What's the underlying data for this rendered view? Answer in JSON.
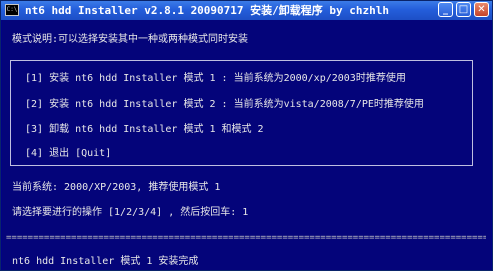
{
  "window": {
    "title": "nt6 hdd Installer v2.8.1 20090717 安装/卸载程序 by chzhlh",
    "icon": "console-app-icon",
    "controls": {
      "minimize_glyph": "_",
      "maximize_glyph": "□",
      "close_glyph": "✕"
    }
  },
  "console": {
    "mode_description": "模式说明:可以选择安装其中一种或两种模式同时安装",
    "menu_items": [
      {
        "text": "[1] 安装 nt6 hdd Installer 模式 1 : 当前系统为2000/xp/2003时推荐使用"
      },
      {
        "text": "[2] 安装 nt6 hdd Installer 模式 2 : 当前系统为vista/2008/7/PE时推荐使用"
      },
      {
        "text": "[3] 卸载 nt6 hdd Installer 模式 1 和模式 2"
      },
      {
        "text": "[4] 退出 [Quit]"
      }
    ],
    "current_system": "当前系统: 2000/XP/2003, 推荐使用模式 1",
    "prompt": "请选择要进行的操作 [1/2/3/4] , 然后按回车: 1",
    "separator": "=========================================================================================",
    "result": "nt6 hdd Installer 模式 1 安装完成"
  },
  "colors": {
    "console_background": "#04047a",
    "console_text": "#e8e8e8",
    "titlebar": "#245edb"
  }
}
